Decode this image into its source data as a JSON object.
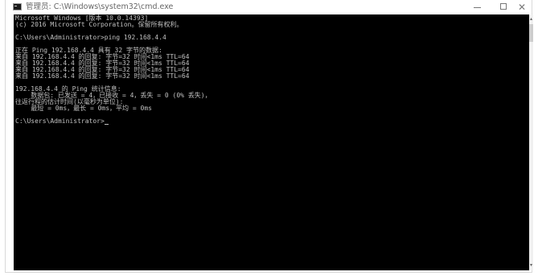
{
  "window": {
    "title": "管理员: C:\\Windows\\system32\\cmd.exe",
    "icon": "console-icon",
    "controls": {
      "minimize_icon": "minimize-icon",
      "maximize_icon": "maximize-icon",
      "close_label": "✕"
    }
  },
  "console": {
    "lines": [
      "Microsoft Windows [版本 10.0.14393]",
      "(c) 2016 Microsoft Corporation。保留所有权利。",
      "",
      "C:\\Users\\Administrator>ping 192.168.4.4",
      "",
      "正在 Ping 192.168.4.4 具有 32 字节的数据:",
      "来自 192.168.4.4 的回复: 字节=32 时间<1ms TTL=64",
      "来自 192.168.4.4 的回复: 字节=32 时间<1ms TTL=64",
      "来自 192.168.4.4 的回复: 字节=32 时间<1ms TTL=64",
      "来自 192.168.4.4 的回复: 字节=32 时间<1ms TTL=64",
      "",
      "192.168.4.4 的 Ping 统计信息:",
      "    数据包: 已发送 = 4，已接收 = 4，丢失 = 0 (0% 丢失)，",
      "往返行程的估计时间(以毫秒为单位):",
      "    最短 = 0ms，最长 = 0ms，平均 = 0ms",
      "",
      "C:\\Users\\Administrator>"
    ],
    "colors": {
      "background": "#000000",
      "text": "#c0c0c0"
    }
  },
  "scrollbar": {
    "up_glyph": "▴",
    "down_glyph": "▾"
  }
}
